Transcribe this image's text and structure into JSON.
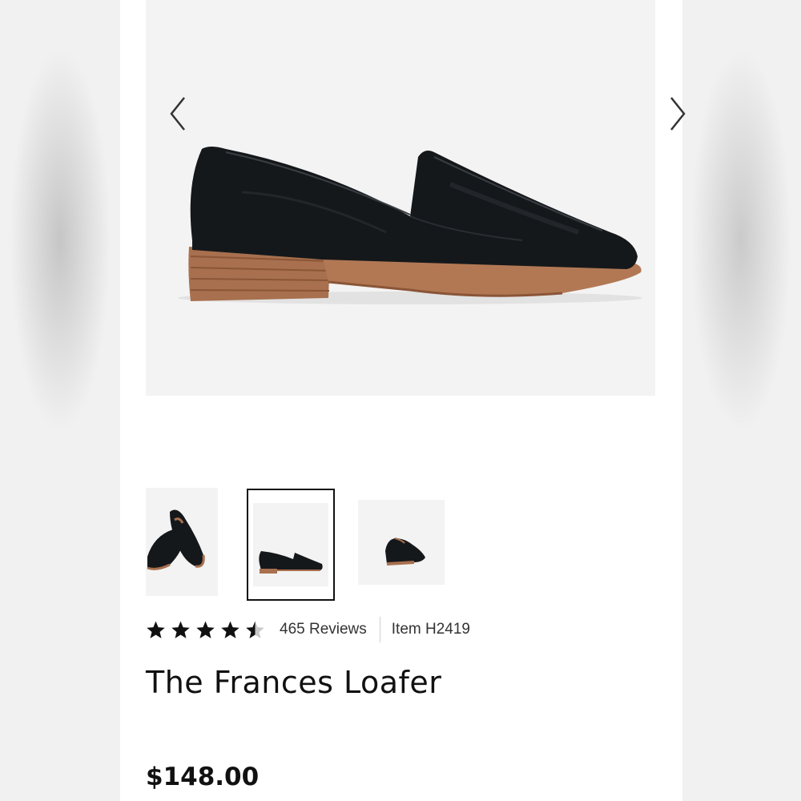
{
  "gallery": {
    "prev_icon": "chevron-left-icon",
    "next_icon": "chevron-right-icon",
    "thumbnail_count": 3,
    "selected_thumbnail": 2
  },
  "rating": {
    "stars": 4.5,
    "max_stars": 5,
    "reviews_label": "465 Reviews",
    "item_label": "Item H2419"
  },
  "product": {
    "title": "The Frances Loafer",
    "price": "$148.00"
  },
  "colors": {
    "leather": "#15181b",
    "sole": "#a8704e",
    "star": "#111111",
    "selected_border": "#111111"
  }
}
